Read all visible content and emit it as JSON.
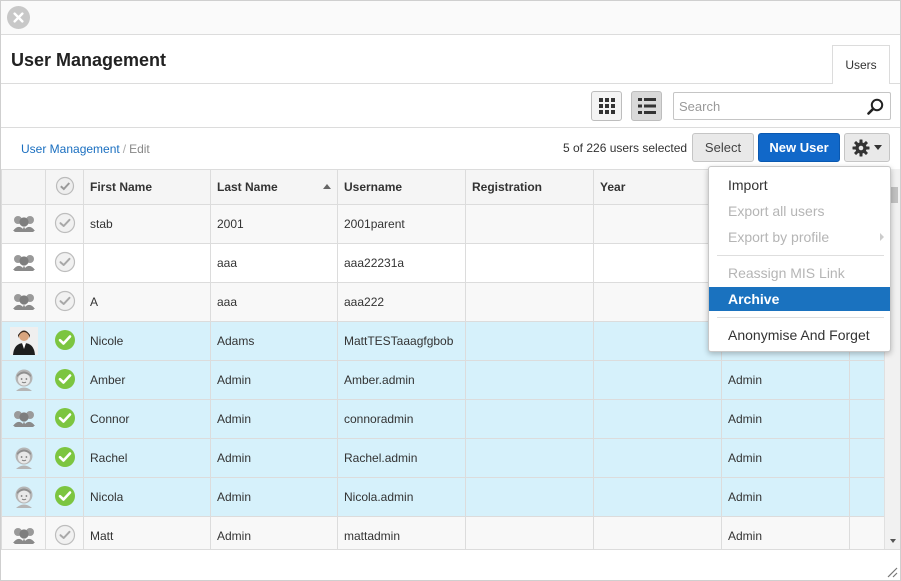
{
  "header": {
    "title": "User Management",
    "tab_users": "Users"
  },
  "toolbar": {
    "search_placeholder": "Search"
  },
  "breadcrumb": {
    "link": "User Management",
    "separator": "/",
    "current": "Edit"
  },
  "actions": {
    "selection_count": "5 of 226 users selected",
    "select_label": "Select",
    "new_user_label": "New User"
  },
  "table": {
    "columns": [
      "First Name",
      "Last Name",
      "Username",
      "Registration",
      "Year"
    ],
    "rows": [
      {
        "first": "stab",
        "last": "2001",
        "username": "2001parent",
        "registration": "",
        "year": "",
        "extra": "",
        "selected": false,
        "avatar": "group-avatar-icon"
      },
      {
        "first": "",
        "last": "aaa",
        "username": "aaa22231a",
        "registration": "",
        "year": "",
        "extra": "",
        "selected": false,
        "avatar": "group-avatar-icon"
      },
      {
        "first": "A",
        "last": "aaa",
        "username": "aaa222",
        "registration": "",
        "year": "",
        "extra": "",
        "selected": false,
        "avatar": "group-avatar-icon"
      },
      {
        "first": "Nicole",
        "last": "Adams",
        "username": "MattTESTaaagfgbob",
        "registration": "",
        "year": "",
        "extra": "",
        "selected": true,
        "avatar": "photo-avatar"
      },
      {
        "first": "Amber",
        "last": "Admin",
        "username": "Amber.admin",
        "registration": "",
        "year": "",
        "extra": "Admin",
        "selected": true,
        "avatar": "female-avatar-icon"
      },
      {
        "first": "Connor",
        "last": "Admin",
        "username": "connoradmin",
        "registration": "",
        "year": "",
        "extra": "Admin",
        "selected": true,
        "avatar": "group-avatar-icon"
      },
      {
        "first": "Rachel",
        "last": "Admin",
        "username": "Rachel.admin",
        "registration": "",
        "year": "",
        "extra": "Admin",
        "selected": true,
        "avatar": "female-avatar-icon"
      },
      {
        "first": "Nicola",
        "last": "Admin",
        "username": "Nicola.admin",
        "registration": "",
        "year": "",
        "extra": "Admin",
        "selected": true,
        "avatar": "female-avatar-icon"
      },
      {
        "first": "Matt",
        "last": "Admin",
        "username": "mattadmin",
        "registration": "",
        "year": "",
        "extra": "Admin",
        "selected": false,
        "avatar": "group-avatar-icon"
      }
    ]
  },
  "menu": {
    "items": [
      {
        "label": "Import",
        "state": "enabled"
      },
      {
        "label": "Export all users",
        "state": "disabled"
      },
      {
        "label": "Export by profile",
        "state": "disabled"
      },
      {
        "label": "Reassign MIS Link",
        "state": "disabled"
      },
      {
        "label": "Archive",
        "state": "active"
      },
      {
        "label": "Anonymise And Forget",
        "state": "enabled"
      }
    ]
  },
  "colors": {
    "accent": "#1168c9",
    "selected_row": "#d6f1fb",
    "check_green": "#7cc540",
    "menu_active": "#1a72bf"
  }
}
